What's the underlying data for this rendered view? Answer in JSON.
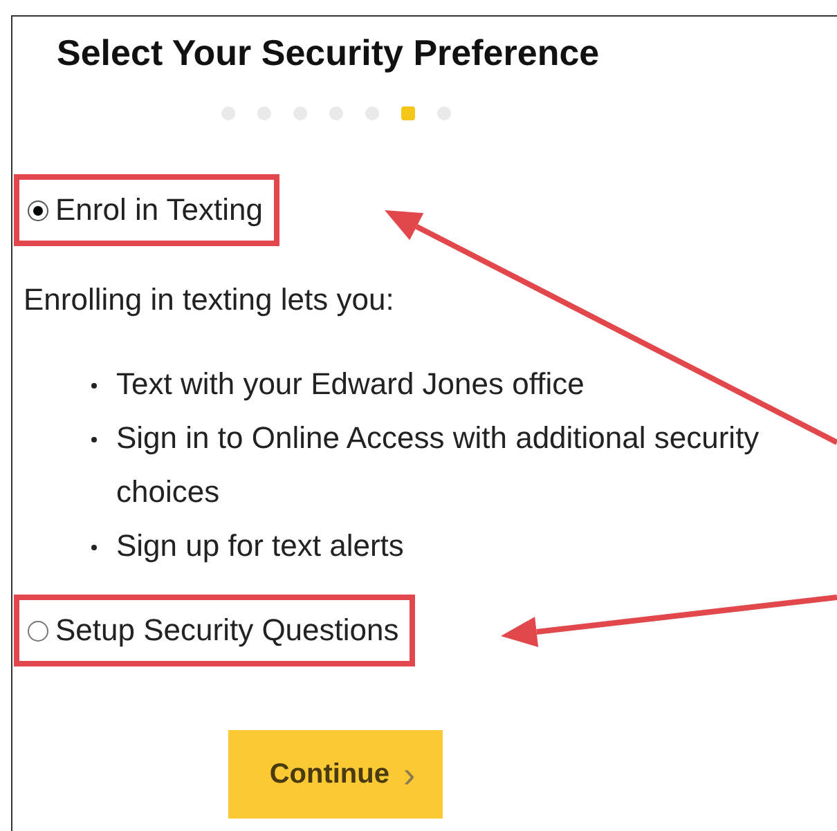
{
  "title": "Select Your Security Preference",
  "steps": [
    {
      "selected": false
    },
    {
      "selected": false
    },
    {
      "selected": false
    },
    {
      "selected": false
    },
    {
      "selected": false
    },
    {
      "selected": true
    },
    {
      "selected": false
    }
  ],
  "options": [
    {
      "label": "Enrol in Texting",
      "selected": true,
      "annotated": true,
      "intro": "Enrolling in texting lets you:",
      "bullets": [
        "Text with your Edward Jones office",
        "Sign in to Online Access with additional security choices",
        "Sign up for text alerts"
      ]
    },
    {
      "label": "Setup Security Questions",
      "selected": false,
      "annotated": true
    }
  ],
  "button": {
    "label": "Continue",
    "icon": "›"
  }
}
